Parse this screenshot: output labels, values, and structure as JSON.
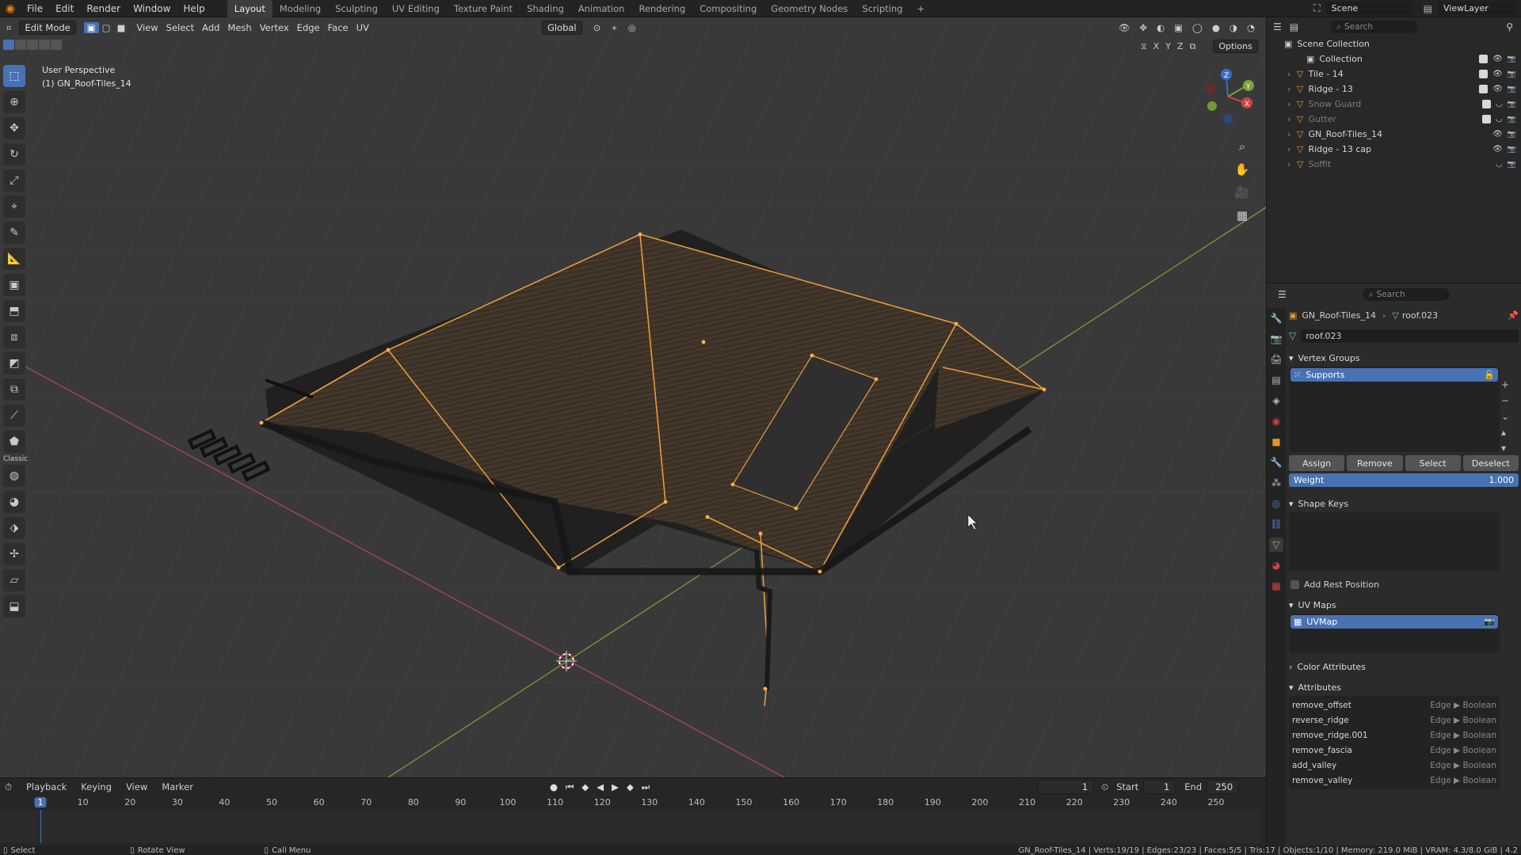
{
  "topbar": {
    "menus": [
      "File",
      "Edit",
      "Render",
      "Window",
      "Help"
    ],
    "workspaces": [
      "Layout",
      "Modeling",
      "Sculpting",
      "UV Editing",
      "Texture Paint",
      "Shading",
      "Animation",
      "Rendering",
      "Compositing",
      "Geometry Nodes",
      "Scripting"
    ],
    "active_workspace": "Layout",
    "add_tab": "+",
    "scene_label": "Scene",
    "viewlayer_label": "ViewLayer"
  },
  "viewport": {
    "mode": "Edit Mode",
    "menus": [
      "View",
      "Select",
      "Add",
      "Mesh",
      "Vertex",
      "Edge",
      "Face",
      "UV"
    ],
    "orientation": "Global",
    "options": "Options",
    "axes": [
      "X",
      "Y",
      "Z"
    ],
    "overlay_title": "User Perspective",
    "overlay_object": "(1) GN_Roof-Tiles_14",
    "grid_color": "#454545",
    "x_axis_color": "#b84a4a",
    "y_axis_color": "#7aa33a",
    "selection_color": "#e89a3a",
    "gizmo": {
      "x": "X",
      "y": "Y",
      "z": "Z"
    }
  },
  "toolbar": {
    "tools": [
      "select-box-icon",
      "cursor-icon",
      "move-icon",
      "rotate-icon",
      "scale-icon",
      "transform-icon",
      "annotate-icon",
      "measure-icon",
      "add-cube-icon",
      "extrude-icon",
      "inset-icon",
      "bevel-icon",
      "loop-cut-icon",
      "knife-icon",
      "poly-build-icon",
      "classic-label",
      "spin-icon",
      "smooth-icon",
      "edge-slide-icon",
      "shrink-icon",
      "shear-icon",
      "rip-icon"
    ],
    "classic_label": "Classic"
  },
  "timeline": {
    "menus": [
      "Playback",
      "Keying",
      "View",
      "Marker"
    ],
    "current_frame": "1",
    "start_label": "Start",
    "start": "1",
    "end_label": "End",
    "end": "250",
    "ticks": [
      "1",
      "10",
      "20",
      "30",
      "40",
      "50",
      "60",
      "70",
      "80",
      "90",
      "100",
      "110",
      "120",
      "130",
      "140",
      "150",
      "160",
      "170",
      "180",
      "190",
      "200",
      "210",
      "220",
      "230",
      "240",
      "250"
    ]
  },
  "status": {
    "left": [
      {
        "key": "select",
        "label": "Select"
      },
      {
        "key": "rotate",
        "label": "Rotate View"
      },
      {
        "key": "menu",
        "label": "Call Menu"
      }
    ],
    "right": "GN_Roof-Tiles_14 | Verts:19/19 | Edges:23/23 | Faces:5/5 | Tris:17 | Objects:1/10 | Memory: 219.0 MiB | VRAM: 4.3/8.0 GiB | 4.2"
  },
  "outliner": {
    "search_placeholder": "Search",
    "root": "Scene Collection",
    "items": [
      {
        "label": "Collection",
        "dim": false,
        "checked": true
      },
      {
        "label": "Tile - 14",
        "dim": false,
        "checked": true
      },
      {
        "label": "Ridge - 13",
        "dim": false,
        "checked": true
      },
      {
        "label": "Snow Guard",
        "dim": true,
        "checked": true
      },
      {
        "label": "Gutter",
        "dim": true,
        "checked": true
      },
      {
        "label": "GN_Roof-Tiles_14",
        "dim": false,
        "checked": false
      },
      {
        "label": "Ridge - 13 cap",
        "dim": false,
        "checked": false
      },
      {
        "label": "Soffit",
        "dim": true,
        "checked": false
      }
    ]
  },
  "properties": {
    "search_placeholder": "Search",
    "breadcrumb_object": "GN_Roof-Tiles_14",
    "breadcrumb_mesh": "roof.023",
    "mesh_name": "roof.023",
    "vertex_groups_title": "Vertex Groups",
    "vertex_group_selected": "Supports",
    "assign": "Assign",
    "remove": "Remove",
    "select": "Select",
    "deselect": "Deselect",
    "weight_label": "Weight",
    "weight_value": "1.000",
    "shape_keys_title": "Shape Keys",
    "add_rest_position": "Add Rest Position",
    "uv_maps_title": "UV Maps",
    "uv_map_selected": "UVMap",
    "color_attributes_title": "Color Attributes",
    "attributes_title": "Attributes",
    "attributes": [
      {
        "name": "remove_offset",
        "type": "Edge ▶ Boolean"
      },
      {
        "name": "reverse_ridge",
        "type": "Edge ▶ Boolean"
      },
      {
        "name": "remove_ridge.001",
        "type": "Edge ▶ Boolean"
      },
      {
        "name": "remove_fascia",
        "type": "Edge ▶ Boolean"
      },
      {
        "name": "add_valley",
        "type": "Edge ▶ Boolean"
      },
      {
        "name": "remove_valley",
        "type": "Edge ▶ Boolean"
      }
    ]
  }
}
